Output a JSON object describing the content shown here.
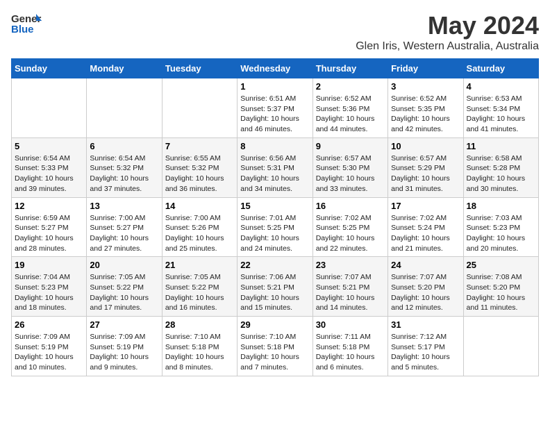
{
  "logo": {
    "general": "General",
    "blue": "Blue"
  },
  "title": "May 2024",
  "subtitle": "Glen Iris, Western Australia, Australia",
  "days_header": [
    "Sunday",
    "Monday",
    "Tuesday",
    "Wednesday",
    "Thursday",
    "Friday",
    "Saturday"
  ],
  "weeks": [
    [
      {
        "day": "",
        "info": ""
      },
      {
        "day": "",
        "info": ""
      },
      {
        "day": "",
        "info": ""
      },
      {
        "day": "1",
        "info": "Sunrise: 6:51 AM\nSunset: 5:37 PM\nDaylight: 10 hours\nand 46 minutes."
      },
      {
        "day": "2",
        "info": "Sunrise: 6:52 AM\nSunset: 5:36 PM\nDaylight: 10 hours\nand 44 minutes."
      },
      {
        "day": "3",
        "info": "Sunrise: 6:52 AM\nSunset: 5:35 PM\nDaylight: 10 hours\nand 42 minutes."
      },
      {
        "day": "4",
        "info": "Sunrise: 6:53 AM\nSunset: 5:34 PM\nDaylight: 10 hours\nand 41 minutes."
      }
    ],
    [
      {
        "day": "5",
        "info": "Sunrise: 6:54 AM\nSunset: 5:33 PM\nDaylight: 10 hours\nand 39 minutes."
      },
      {
        "day": "6",
        "info": "Sunrise: 6:54 AM\nSunset: 5:32 PM\nDaylight: 10 hours\nand 37 minutes."
      },
      {
        "day": "7",
        "info": "Sunrise: 6:55 AM\nSunset: 5:32 PM\nDaylight: 10 hours\nand 36 minutes."
      },
      {
        "day": "8",
        "info": "Sunrise: 6:56 AM\nSunset: 5:31 PM\nDaylight: 10 hours\nand 34 minutes."
      },
      {
        "day": "9",
        "info": "Sunrise: 6:57 AM\nSunset: 5:30 PM\nDaylight: 10 hours\nand 33 minutes."
      },
      {
        "day": "10",
        "info": "Sunrise: 6:57 AM\nSunset: 5:29 PM\nDaylight: 10 hours\nand 31 minutes."
      },
      {
        "day": "11",
        "info": "Sunrise: 6:58 AM\nSunset: 5:28 PM\nDaylight: 10 hours\nand 30 minutes."
      }
    ],
    [
      {
        "day": "12",
        "info": "Sunrise: 6:59 AM\nSunset: 5:27 PM\nDaylight: 10 hours\nand 28 minutes."
      },
      {
        "day": "13",
        "info": "Sunrise: 7:00 AM\nSunset: 5:27 PM\nDaylight: 10 hours\nand 27 minutes."
      },
      {
        "day": "14",
        "info": "Sunrise: 7:00 AM\nSunset: 5:26 PM\nDaylight: 10 hours\nand 25 minutes."
      },
      {
        "day": "15",
        "info": "Sunrise: 7:01 AM\nSunset: 5:25 PM\nDaylight: 10 hours\nand 24 minutes."
      },
      {
        "day": "16",
        "info": "Sunrise: 7:02 AM\nSunset: 5:25 PM\nDaylight: 10 hours\nand 22 minutes."
      },
      {
        "day": "17",
        "info": "Sunrise: 7:02 AM\nSunset: 5:24 PM\nDaylight: 10 hours\nand 21 minutes."
      },
      {
        "day": "18",
        "info": "Sunrise: 7:03 AM\nSunset: 5:23 PM\nDaylight: 10 hours\nand 20 minutes."
      }
    ],
    [
      {
        "day": "19",
        "info": "Sunrise: 7:04 AM\nSunset: 5:23 PM\nDaylight: 10 hours\nand 18 minutes."
      },
      {
        "day": "20",
        "info": "Sunrise: 7:05 AM\nSunset: 5:22 PM\nDaylight: 10 hours\nand 17 minutes."
      },
      {
        "day": "21",
        "info": "Sunrise: 7:05 AM\nSunset: 5:22 PM\nDaylight: 10 hours\nand 16 minutes."
      },
      {
        "day": "22",
        "info": "Sunrise: 7:06 AM\nSunset: 5:21 PM\nDaylight: 10 hours\nand 15 minutes."
      },
      {
        "day": "23",
        "info": "Sunrise: 7:07 AM\nSunset: 5:21 PM\nDaylight: 10 hours\nand 14 minutes."
      },
      {
        "day": "24",
        "info": "Sunrise: 7:07 AM\nSunset: 5:20 PM\nDaylight: 10 hours\nand 12 minutes."
      },
      {
        "day": "25",
        "info": "Sunrise: 7:08 AM\nSunset: 5:20 PM\nDaylight: 10 hours\nand 11 minutes."
      }
    ],
    [
      {
        "day": "26",
        "info": "Sunrise: 7:09 AM\nSunset: 5:19 PM\nDaylight: 10 hours\nand 10 minutes."
      },
      {
        "day": "27",
        "info": "Sunrise: 7:09 AM\nSunset: 5:19 PM\nDaylight: 10 hours\nand 9 minutes."
      },
      {
        "day": "28",
        "info": "Sunrise: 7:10 AM\nSunset: 5:18 PM\nDaylight: 10 hours\nand 8 minutes."
      },
      {
        "day": "29",
        "info": "Sunrise: 7:10 AM\nSunset: 5:18 PM\nDaylight: 10 hours\nand 7 minutes."
      },
      {
        "day": "30",
        "info": "Sunrise: 7:11 AM\nSunset: 5:18 PM\nDaylight: 10 hours\nand 6 minutes."
      },
      {
        "day": "31",
        "info": "Sunrise: 7:12 AM\nSunset: 5:17 PM\nDaylight: 10 hours\nand 5 minutes."
      },
      {
        "day": "",
        "info": ""
      }
    ]
  ]
}
